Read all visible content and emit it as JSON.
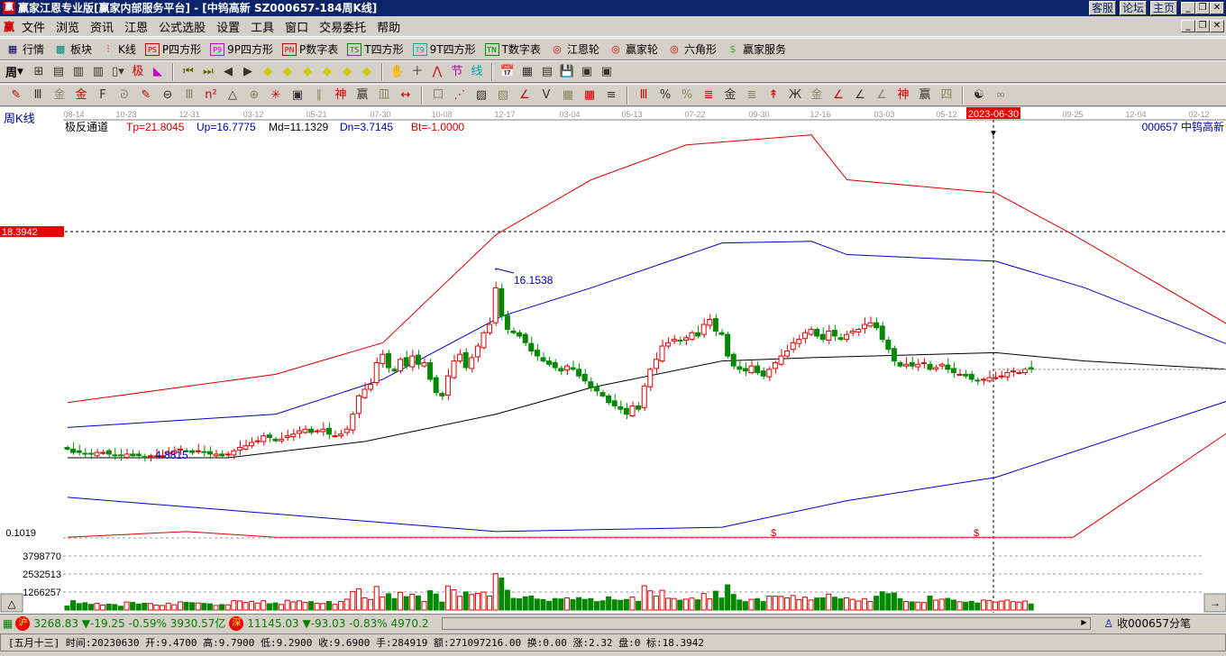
{
  "window": {
    "title": "赢家江恩专业版[赢家内部服务平台] - [中钨高新   SZ000657-184周K线]",
    "logo": "赢",
    "links": [
      "客服",
      "论坛",
      "主页"
    ]
  },
  "menu": [
    "文件",
    "浏览",
    "资讯",
    "江恩",
    "公式选股",
    "设置",
    "工具",
    "窗口",
    "交易委托",
    "帮助"
  ],
  "toolbar1": [
    {
      "icon": "quote-table-icon",
      "label": "行情"
    },
    {
      "icon": "sector-grid-icon",
      "label": "板块"
    },
    {
      "icon": "kline-icon",
      "label": "K线"
    },
    {
      "icon": "ps-box-icon",
      "tag": "PS",
      "label": "P四方形"
    },
    {
      "icon": "p9-box-icon",
      "tag": "P9",
      "label": "9P四方形"
    },
    {
      "icon": "pn-box-icon",
      "tag": "PN",
      "label": "P数字表"
    },
    {
      "icon": "ts-box-icon",
      "tag": "TS",
      "label": "T四方形"
    },
    {
      "icon": "t9-box-icon",
      "tag": "T9",
      "label": "9T四方形"
    },
    {
      "icon": "tn-box-icon",
      "tag": "TN",
      "label": "T数字表"
    },
    {
      "icon": "gann-wheel-icon",
      "label": "江恩轮"
    },
    {
      "icon": "winner-wheel-icon",
      "label": "赢家轮"
    },
    {
      "icon": "hexagon-icon",
      "label": "六角形"
    },
    {
      "icon": "dollar-icon",
      "label": "赢家服务"
    }
  ],
  "toolbar2": {
    "period": "周"
  },
  "chart": {
    "period_label": "周K线",
    "indicator_name": "极反通道",
    "params": {
      "tp": "Tp=21.8045",
      "up": "Up=16.7775",
      "md": "Md=11.1329",
      "dn": "Dn=3.7145",
      "bt": "Bt=-1.0000"
    },
    "stock": "000657  中钨高新",
    "time_ticks": [
      "08-14",
      "10-23",
      "12-31",
      "03-12",
      "05-21",
      "07-30",
      "10-08",
      "12-17",
      "03-04",
      "05-13",
      "07-22",
      "09-30",
      "12-16",
      "03-03",
      "05-12",
      "09-25",
      "12-04",
      "02-12"
    ],
    "cursor_date": "2023-06-30",
    "cursor_price": "18.3942",
    "high_label": "16.1538",
    "low_label": "4.8815",
    "sub_label": "0.1019",
    "vol_ticks": [
      "3798770",
      "2532513",
      "1266257"
    ],
    "dollar_marks": [
      "$",
      "$"
    ]
  },
  "chart_data": {
    "type": "candlestick",
    "closes": [
      5.4,
      5.2,
      5.2,
      5.1,
      5.1,
      5.2,
      5.2,
      5.1,
      5.0,
      5.0,
      5.1,
      5.0,
      5.0,
      4.9,
      5.0,
      5.0,
      5.0,
      5.2,
      5.3,
      5.4,
      5.3,
      5.2,
      5.3,
      5.2,
      5.1,
      5.1,
      5.0,
      5.1,
      5.3,
      5.5,
      5.6,
      5.8,
      5.9,
      6.2,
      6.1,
      5.9,
      6.0,
      6.2,
      6.3,
      6.5,
      6.6,
      6.4,
      6.5,
      6.6,
      6.3,
      6.2,
      6.3,
      6.6,
      7.5,
      8.6,
      9.0,
      9.3,
      10.6,
      11.1,
      10.3,
      10.1,
      10.8,
      10.4,
      11.0,
      10.5,
      10.6,
      9.6,
      8.8,
      8.6,
      9.8,
      10.7,
      11.1,
      10.3,
      10.9,
      11.6,
      12.4,
      12.9,
      15.1,
      13.4,
      12.6,
      12.4,
      12.2,
      11.8,
      11.3,
      11.0,
      10.7,
      10.5,
      10.3,
      10.1,
      10.4,
      10.2,
      9.8,
      9.5,
      9.1,
      8.9,
      8.6,
      8.2,
      8.0,
      7.8,
      7.5,
      8.0,
      7.8,
      9.2,
      10.2,
      10.8,
      11.6,
      11.8,
      12.0,
      11.9,
      12.1,
      12.4,
      12.2,
      12.9,
      13.2,
      12.5,
      12.3,
      11.0,
      10.4,
      10.2,
      10.1,
      10.4,
      10.0,
      9.8,
      10.2,
      10.6,
      11.0,
      11.3,
      11.8,
      12.0,
      12.4,
      12.6,
      12.2,
      12.0,
      12.5,
      12.2,
      12.0,
      12.3,
      12.5,
      12.6,
      12.9,
      13.0,
      12.7,
      12.0,
      11.4,
      10.7,
      10.4,
      10.5,
      10.4,
      10.5,
      10.6,
      10.2,
      10.3,
      10.5,
      10.2,
      10.0,
      9.9,
      9.8,
      9.6,
      9.5,
      9.6,
      9.7,
      9.7,
      9.8,
      10.0,
      10.1,
      10.0,
      10.2,
      10.2
    ],
    "channel": {
      "tp": [
        [
          0,
          8.2
        ],
        [
          35,
          9.9
        ],
        [
          53,
          11.8
        ],
        [
          72,
          18.3
        ],
        [
          88,
          21.6
        ],
        [
          104,
          23.7
        ],
        [
          125,
          24.3
        ],
        [
          131,
          21.6
        ],
        [
          156,
          20.8
        ],
        [
          169,
          18.3
        ],
        [
          195,
          12.9
        ]
      ],
      "up": [
        [
          0,
          6.7
        ],
        [
          35,
          7.5
        ],
        [
          53,
          9.6
        ],
        [
          73,
          13.4
        ],
        [
          88,
          15.1
        ],
        [
          110,
          17.8
        ],
        [
          125,
          17.9
        ],
        [
          131,
          17.1
        ],
        [
          156,
          16.7
        ],
        [
          171,
          15.1
        ],
        [
          195,
          11.7
        ]
      ],
      "md": [
        [
          0,
          4.88
        ],
        [
          27,
          4.88
        ],
        [
          50,
          5.86
        ],
        [
          72,
          7.5
        ],
        [
          88,
          9.1
        ],
        [
          110,
          10.7
        ],
        [
          125,
          10.9
        ],
        [
          156,
          11.2
        ],
        [
          171,
          10.7
        ],
        [
          195,
          10.2
        ]
      ],
      "dn": [
        [
          0,
          2.5
        ],
        [
          35,
          1.5
        ],
        [
          72,
          0.44
        ],
        [
          110,
          0.7
        ],
        [
          131,
          2.3
        ],
        [
          156,
          3.7
        ],
        [
          195,
          8.3
        ]
      ],
      "bt": [
        [
          0,
          0.1
        ],
        [
          20,
          0.44
        ],
        [
          35,
          0.1
        ],
        [
          169,
          0.1
        ],
        [
          195,
          6.4
        ]
      ]
    },
    "ylim": [
      0,
      25
    ],
    "volume_max": 3798770
  },
  "status": {
    "sh_badge": "沪",
    "sh": "3268.83 ▼-19.25 -0.59% 3930.57亿",
    "sz_badge": "深",
    "sz": "11145.03 ▼-93.03 -0.83% 4970.2",
    "right": "收000657分笔",
    "info": "[五月十三] 时间:20230630 开:9.4700 高:9.7900 低:9.2900 收:9.6900 手:284919 额:271097216.00 换:0.00 涨:2.32 盘:0 标:18.3942"
  }
}
